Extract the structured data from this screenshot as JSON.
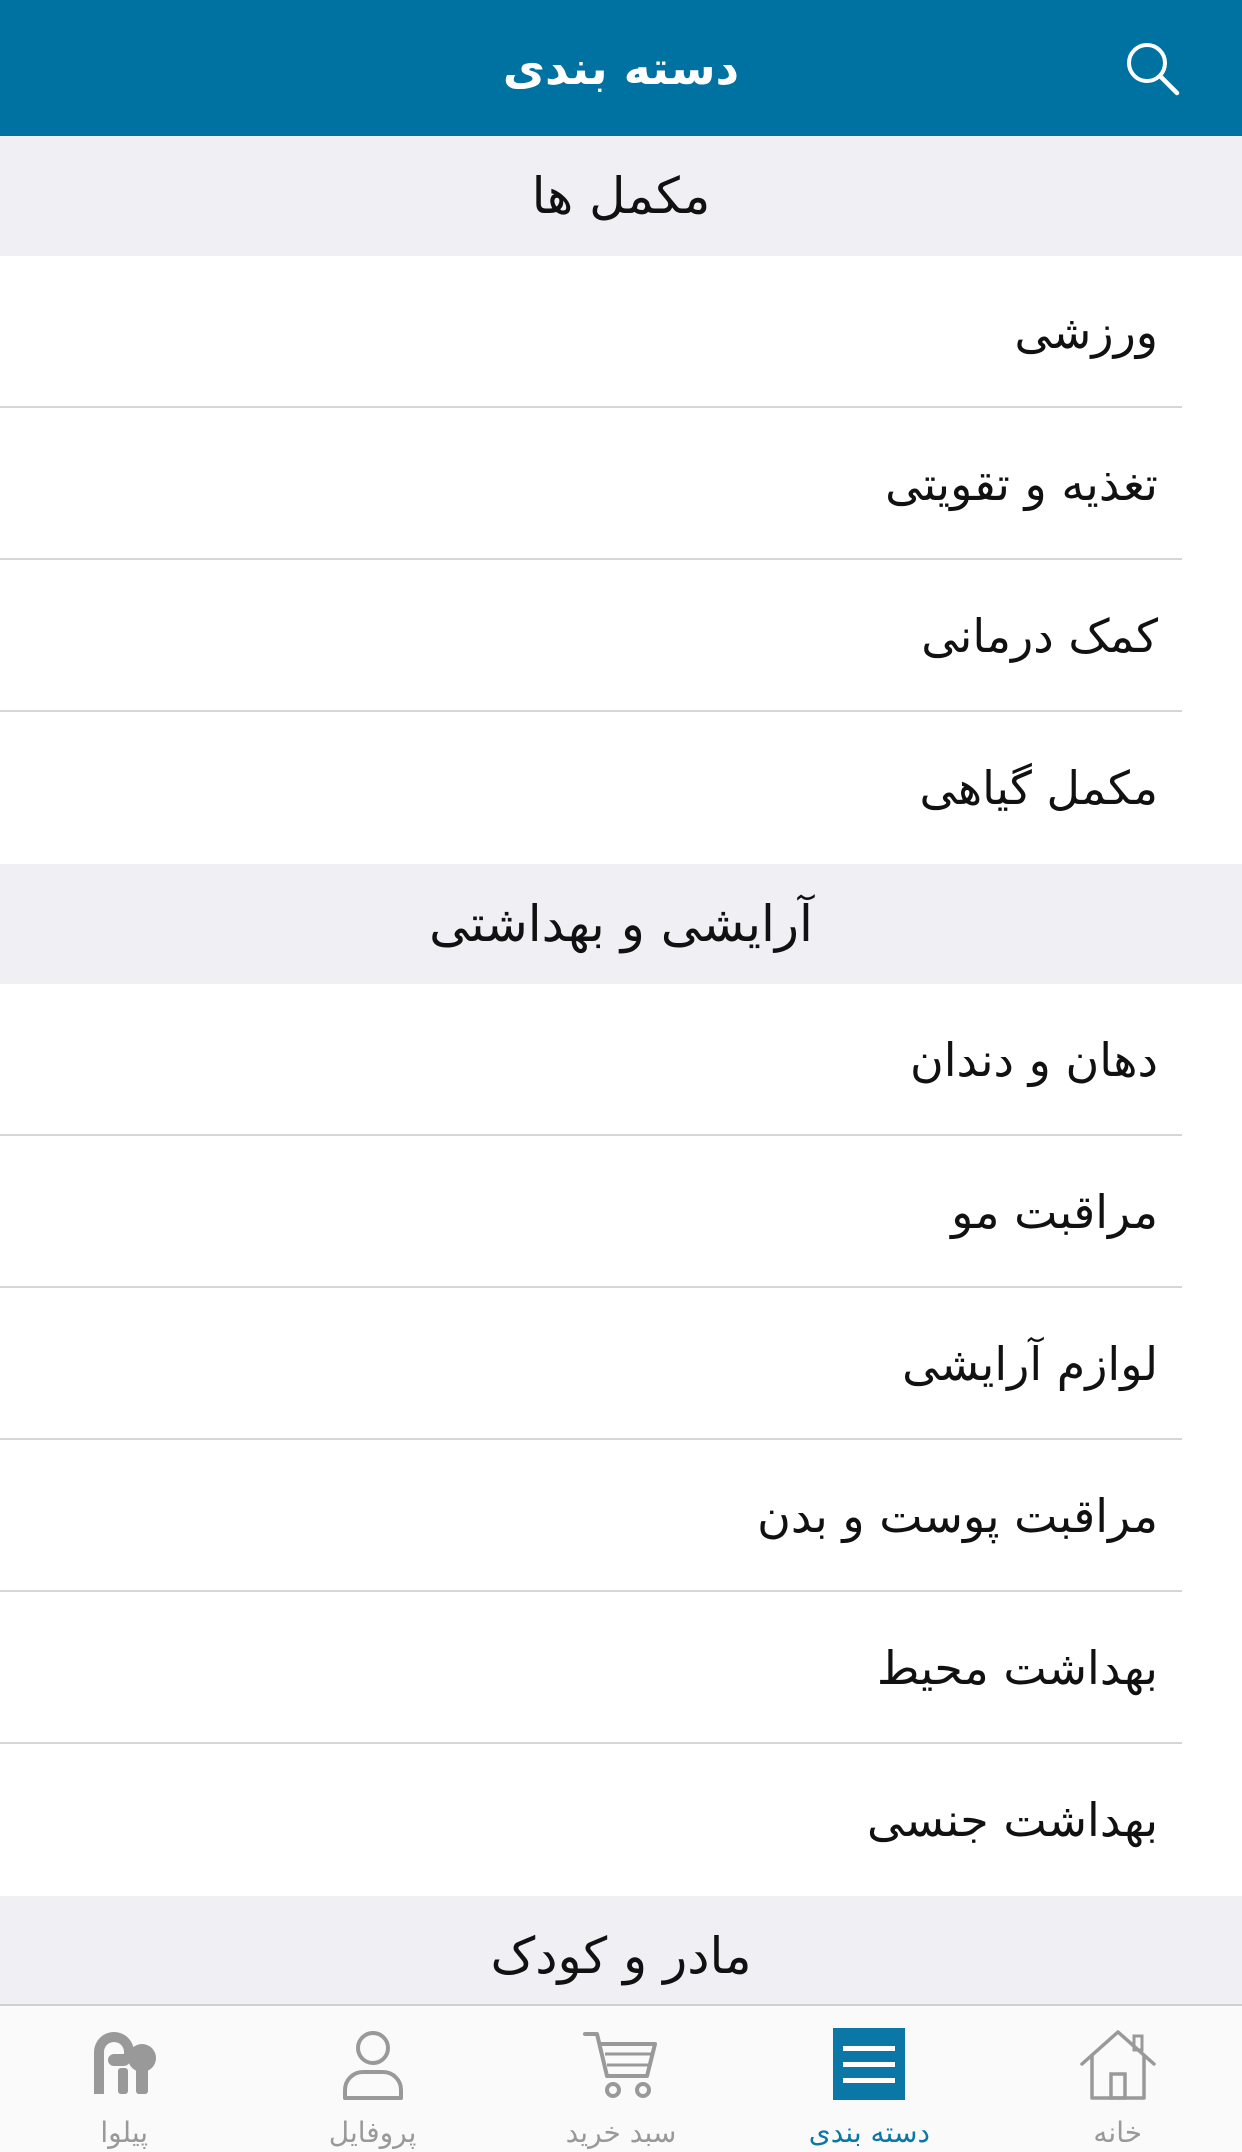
{
  "colors": {
    "header_bg": "#0072a1",
    "accent": "#0a77a6",
    "inactive": "#999999",
    "section_bg": "#efeff4"
  },
  "header": {
    "title": "دسته بندی",
    "search_icon": "search-icon"
  },
  "sections": [
    {
      "title": "مکمل ها",
      "items": [
        "ورزشی",
        "تغذیه و تقویتی",
        "کمک درمانی",
        "مکمل گیاهی"
      ]
    },
    {
      "title": "آرایشی و بهداشتی",
      "items": [
        "دهان و دندان",
        "مراقبت مو",
        "لوازم آرایشی",
        "مراقبت پوست و بدن",
        "بهداشت محیط",
        "بهداشت جنسی"
      ]
    },
    {
      "title": "مادر و کودک",
      "items": []
    }
  ],
  "tabbar": {
    "tabs": [
      {
        "label": "پیلوا",
        "icon": "pilva-logo-icon",
        "active": false
      },
      {
        "label": "پروفایل",
        "icon": "profile-icon",
        "active": false
      },
      {
        "label": "سبد خرید",
        "icon": "cart-icon",
        "active": false
      },
      {
        "label": "دسته بندی",
        "icon": "category-list-icon",
        "active": true
      },
      {
        "label": "خانه",
        "icon": "home-icon",
        "active": false
      }
    ]
  }
}
